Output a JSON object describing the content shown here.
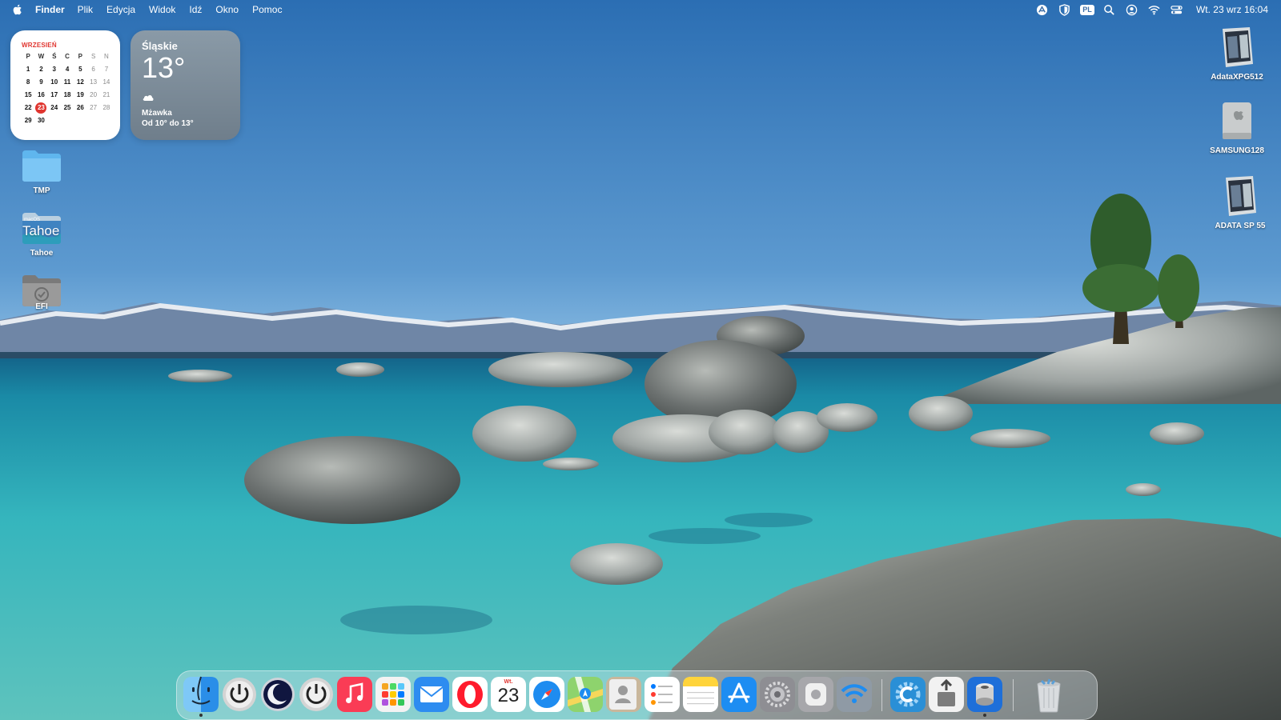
{
  "menubar": {
    "app_name": "Finder",
    "menus": [
      "Plik",
      "Edycja",
      "Widok",
      "Idź",
      "Okno",
      "Pomoc"
    ],
    "input_source": "PL",
    "clock": "Wt. 23 wrz  16:04",
    "status_icons": [
      "accessibility-icon",
      "shield-icon",
      "input-source-icon",
      "search-icon",
      "user-icon",
      "wifi-icon",
      "control-center-icon"
    ]
  },
  "calendar_widget": {
    "month": "WRZESIEŃ",
    "weekdays": [
      "P",
      "W",
      "Ś",
      "C",
      "P",
      "S",
      "N"
    ],
    "weeks": [
      [
        "1",
        "2",
        "3",
        "4",
        "5",
        "6",
        "7"
      ],
      [
        "8",
        "9",
        "10",
        "11",
        "12",
        "13",
        "14"
      ],
      [
        "15",
        "16",
        "17",
        "18",
        "19",
        "20",
        "21"
      ],
      [
        "22",
        "23",
        "24",
        "25",
        "26",
        "27",
        "28"
      ],
      [
        "29",
        "30",
        "",
        "",
        "",
        "",
        ""
      ]
    ],
    "today": "23"
  },
  "weather_widget": {
    "location": "Śląskie",
    "temperature": "13°",
    "condition": "Mżawka",
    "range": "Od 10° do 13°",
    "condition_icon": "cloud-icon"
  },
  "desktop": {
    "left_icons": [
      {
        "label": "TMP",
        "icon": "folder-icon"
      },
      {
        "label": "Tahoe",
        "icon": "macos-tahoe-folder-icon",
        "badge_text": "Tahoe",
        "badge_small": "macOS"
      },
      {
        "label": "EFI",
        "icon": "efi-disk-icon"
      }
    ],
    "right_icons": [
      {
        "label": "AdataXPG512",
        "icon": "external-drive-icon"
      },
      {
        "label": "SAMSUNG128",
        "icon": "internal-drive-icon"
      },
      {
        "label": "ADATA SP 55",
        "icon": "external-drive-icon"
      }
    ]
  },
  "dock": {
    "apps": [
      {
        "name": "Finder",
        "icon": "finder-icon",
        "running": true
      },
      {
        "name": "Shut Down",
        "icon": "power-icon"
      },
      {
        "name": "Sleep",
        "icon": "sleep-moon-icon"
      },
      {
        "name": "Restart",
        "icon": "restart-icon"
      },
      {
        "name": "Music",
        "icon": "music-icon"
      },
      {
        "name": "Launchpad",
        "icon": "launchpad-icon"
      },
      {
        "name": "Mail",
        "icon": "mail-icon"
      },
      {
        "name": "Opera",
        "icon": "opera-icon"
      },
      {
        "name": "Calendar",
        "icon": "calendar-icon",
        "day_label": "Wt.",
        "date": "23"
      },
      {
        "name": "Safari",
        "icon": "safari-icon"
      },
      {
        "name": "Maps",
        "icon": "maps-icon"
      },
      {
        "name": "Contacts",
        "icon": "contacts-icon"
      },
      {
        "name": "Reminders",
        "icon": "reminders-icon"
      },
      {
        "name": "Notes",
        "icon": "notes-icon"
      },
      {
        "name": "App Store",
        "icon": "app-store-icon"
      },
      {
        "name": "System Settings",
        "icon": "system-settings-icon"
      },
      {
        "name": "Disk Utility Helper",
        "icon": "gray-app-icon"
      },
      {
        "name": "Wireless Diagnostics",
        "icon": "wifi-app-icon"
      },
      {
        "name": "Clover Configurator",
        "icon": "clover-configurator-icon"
      },
      {
        "name": "Kext Utility",
        "icon": "kext-utility-icon"
      },
      {
        "name": "Disk Tool",
        "icon": "disk-tool-icon",
        "running": true
      },
      {
        "name": "Trash",
        "icon": "trash-icon"
      }
    ]
  },
  "colors": {
    "sky_top": "#2f73b6",
    "sky_bottom": "#7fb5df",
    "water": "#1fa3b8",
    "accent_red": "#e0352f"
  }
}
